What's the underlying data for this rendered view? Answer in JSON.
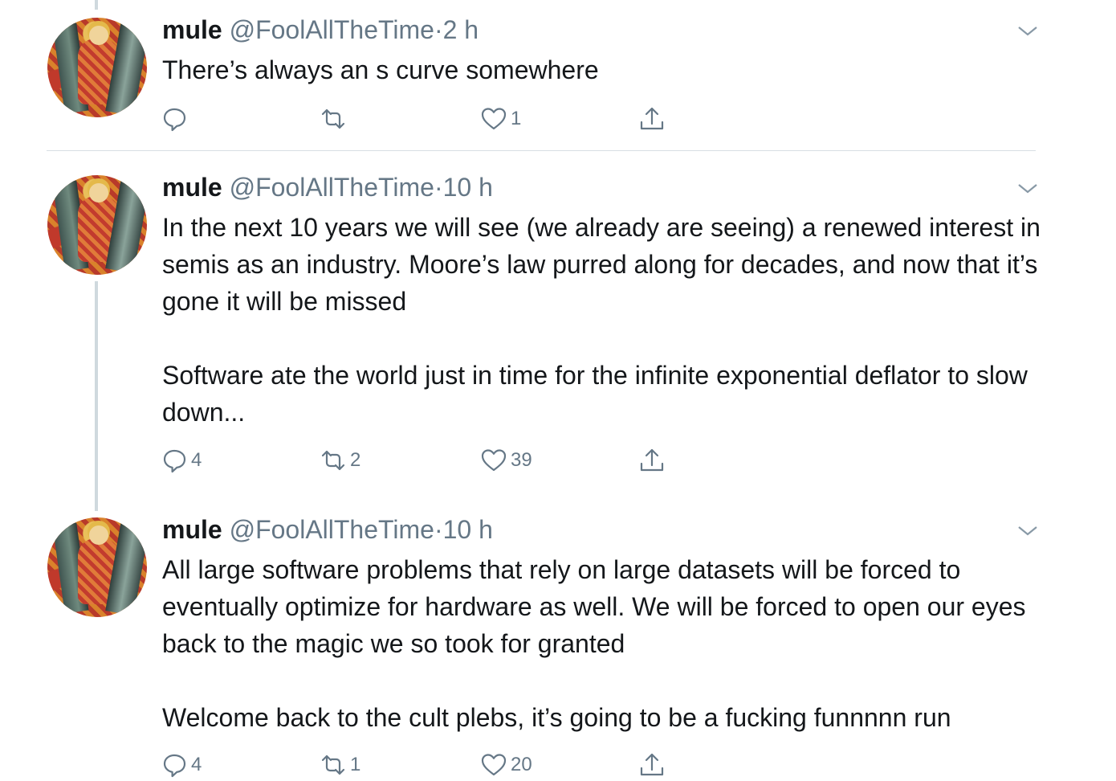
{
  "tweets": [
    {
      "name": "mule",
      "handle": "@FoolAllTheTime",
      "separator": "·",
      "time": "2 h",
      "text": "There’s always an s curve somewhere",
      "replies": "",
      "retweets": "",
      "likes": "1"
    },
    {
      "name": "mule",
      "handle": "@FoolAllTheTime",
      "separator": "·",
      "time": "10 h",
      "text": "In the next 10 years we will see (we already are seeing) a renewed interest in semis as an industry. Moore’s law purred along for decades, and now that it’s gone it will be missed\n\nSoftware ate the world just in time for the infinite exponential deflator to slow down...",
      "replies": "4",
      "retweets": "2",
      "likes": "39"
    },
    {
      "name": "mule",
      "handle": "@FoolAllTheTime",
      "separator": "·",
      "time": "10 h",
      "text": "All large software problems that rely on large datasets will be forced to eventually optimize for hardware as well. We will be forced to open our eyes back to the magic we so took for granted\n\nWelcome back to the cult plebs, it’s going to be a fucking funnnnn run",
      "replies": "4",
      "retweets": "1",
      "likes": "20"
    }
  ],
  "icons": {
    "reply": "reply-icon",
    "retweet": "retweet-icon",
    "like": "heart-icon",
    "share": "share-icon",
    "menu": "chevron-down-icon"
  },
  "colors": {
    "text": "#14171a",
    "secondary": "#657786",
    "thread_line": "#cfd9de",
    "divider": "#d8dee3"
  }
}
